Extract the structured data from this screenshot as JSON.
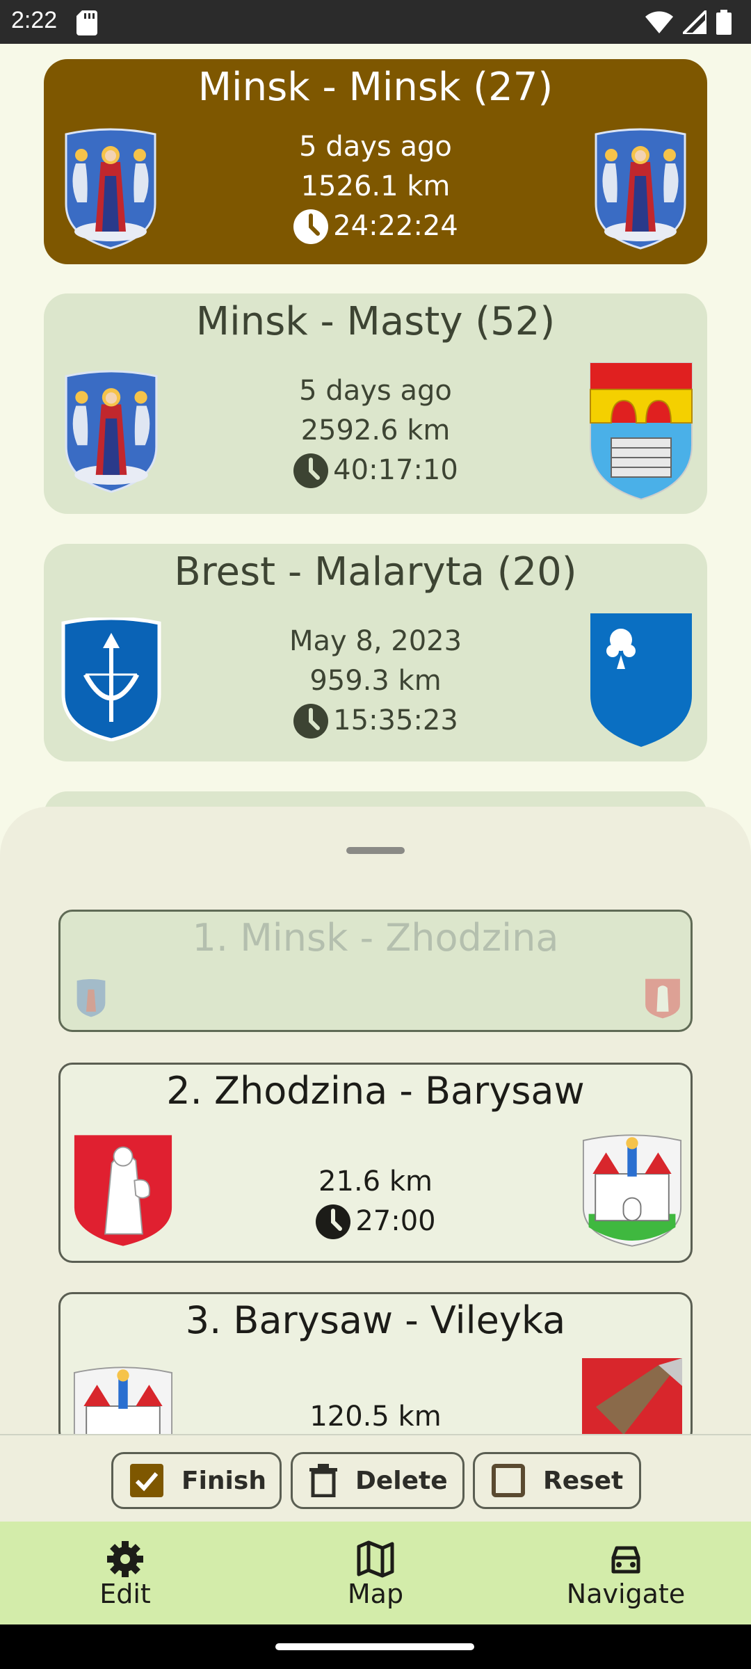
{
  "status_bar": {
    "time": "2:22"
  },
  "routes": [
    {
      "title": "Minsk - Minsk (27)",
      "date": "5 days ago",
      "distance": "1526.1 km",
      "duration": "24:22:24"
    },
    {
      "title": "Minsk - Masty (52)",
      "date": "5 days ago",
      "distance": "2592.6 km",
      "duration": "40:17:10"
    },
    {
      "title": "Brest - Malaryta (20)",
      "date": "May 8, 2023",
      "distance": "959.3 km",
      "duration": "15:35:23"
    }
  ],
  "sheet": {
    "segments": [
      {
        "title": "1. Minsk - Zhodzina"
      },
      {
        "title": "2. Zhodzina - Barysaw",
        "distance": "21.6 km",
        "duration": "27:00"
      },
      {
        "title": "3. Barysaw - Vileyka",
        "distance": "120.5 km"
      }
    ]
  },
  "actions": {
    "finish": "Finish",
    "delete": "Delete",
    "reset": "Reset"
  },
  "nav": {
    "edit": "Edit",
    "map": "Map",
    "navigate": "Navigate"
  }
}
